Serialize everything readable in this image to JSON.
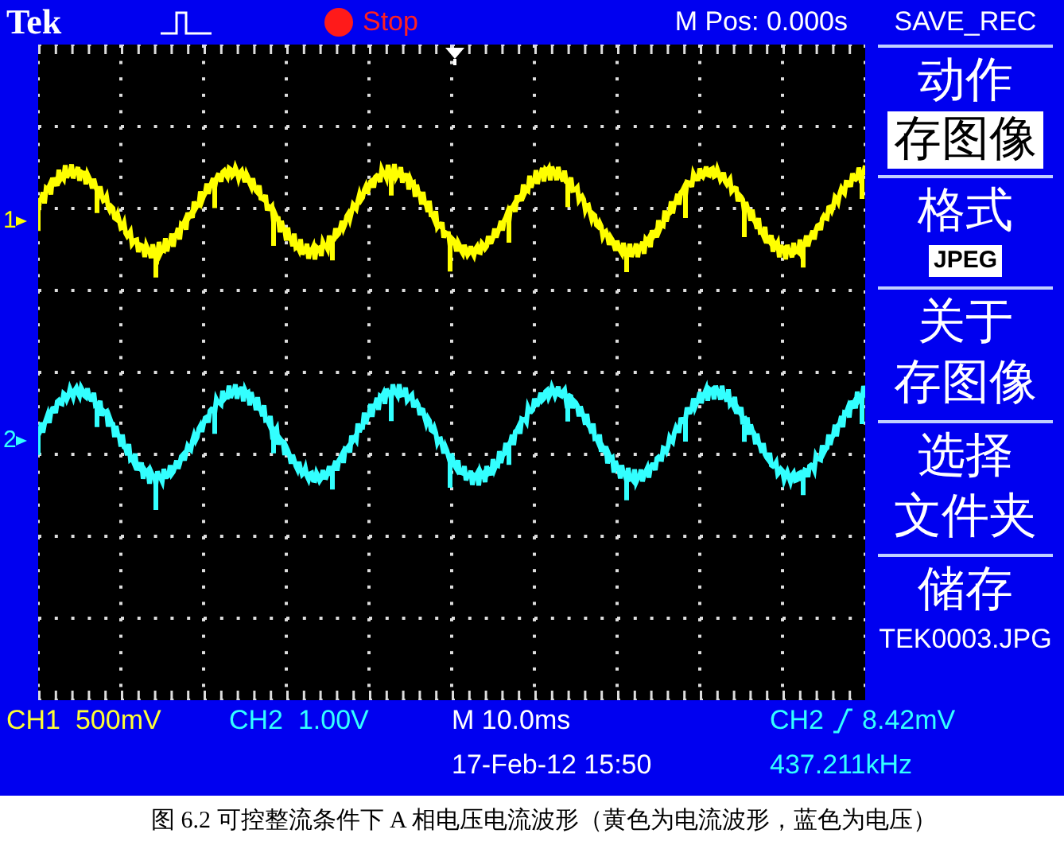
{
  "top_bar": {
    "brand": "Tek",
    "run_state": {
      "label": "Stop",
      "running": false
    },
    "position": "M Pos: 0.000s"
  },
  "channel_markers": [
    {
      "label": "1",
      "color": "#ffff00"
    },
    {
      "label": "2",
      "color": "#33ffff"
    }
  ],
  "menu": {
    "title": "SAVE_REC",
    "sections": [
      {
        "lines": [
          {
            "text": "动作",
            "kind": "heading"
          },
          {
            "text": "存图像",
            "kind": "boxed"
          }
        ]
      },
      {
        "lines": [
          {
            "text": "格式",
            "kind": "heading"
          },
          {
            "text": "JPEG",
            "kind": "boxed-small"
          }
        ]
      },
      {
        "lines": [
          {
            "text": "关于",
            "kind": "heading"
          },
          {
            "text": "存图像",
            "kind": "heading"
          }
        ]
      },
      {
        "lines": [
          {
            "text": "选择",
            "kind": "heading"
          },
          {
            "text": "文件夹",
            "kind": "heading"
          }
        ]
      },
      {
        "lines": [
          {
            "text": "储存",
            "kind": "heading"
          },
          {
            "text": "TEK0003.JPG",
            "kind": "small"
          }
        ]
      }
    ]
  },
  "readouts": [
    {
      "text": "CH1  500mV",
      "color": "#ffff33"
    },
    {
      "text": "CH2  1.00V",
      "color": "#33ffff"
    },
    {
      "text": "M 10.0ms",
      "color": "#ffffff"
    }
  ],
  "trigger": {
    "source": "CH2",
    "level": "8.42mV",
    "color": "#33ffff"
  },
  "date": "17-Feb-12 15:50",
  "frequency": {
    "text": "437.211kHz",
    "color": "#33ffff"
  },
  "caption": "图 6.2  可控整流条件下 A 相电压电流波形（黄色为电流波形，蓝色为电压）"
}
